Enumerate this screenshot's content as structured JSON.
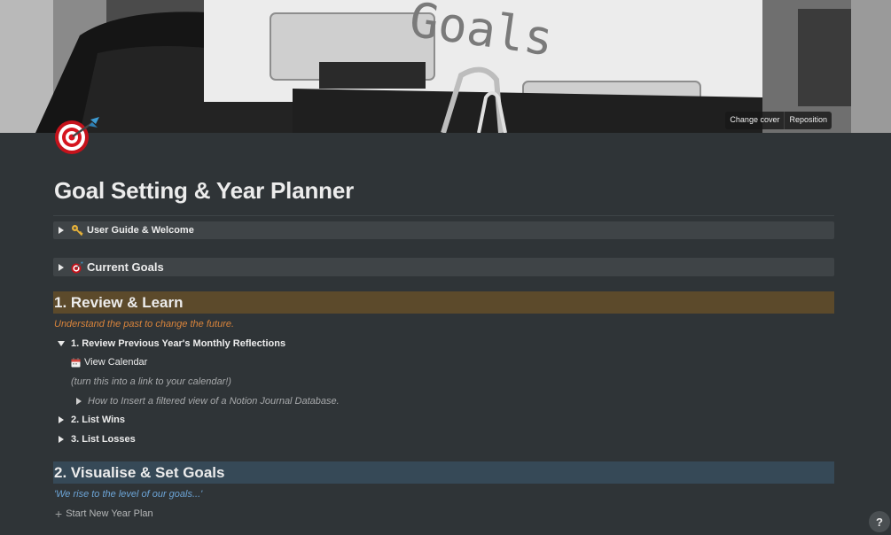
{
  "cover": {
    "typed_word": "Goals",
    "change_cover_label": "Change cover",
    "reposition_label": "Reposition"
  },
  "page": {
    "icon": "target-emoji-icon",
    "title": "Goal Setting & Year Planner"
  },
  "blocks": {
    "user_guide": {
      "icon": "key-emoji-icon",
      "label": "User Guide & Welcome"
    },
    "current_goals": {
      "icon": "dart-emoji-icon",
      "label": "Current Goals"
    }
  },
  "section1": {
    "heading": "1. Review & Learn",
    "subtitle": "Understand the past to change the future.",
    "toggle_monthly": "1. Review Previous Year's Monthly Reflections",
    "view_calendar": {
      "icon": "calendar-emoji-icon",
      "label": "View Calendar"
    },
    "calendar_note": "(turn this into a link to your calendar!)",
    "how_to_toggle": "How to Insert a filtered view of a Notion Journal Database.",
    "toggle_wins": "2. List Wins",
    "toggle_losses": "3. List Losses"
  },
  "section2": {
    "heading": "2. Visualise & Set Goals",
    "quote": "'We rise to the level of our goals...'",
    "new_plan_button": "Start New Year Plan"
  },
  "help": {
    "label": "?"
  },
  "colors": {
    "page_bg": "#2f3437",
    "toggle_bg": "#3f4447",
    "heading_brown": "#5c4a2b",
    "heading_blue": "#364957",
    "orange_text": "#d9843b",
    "blue_text": "#6ca4d6"
  }
}
